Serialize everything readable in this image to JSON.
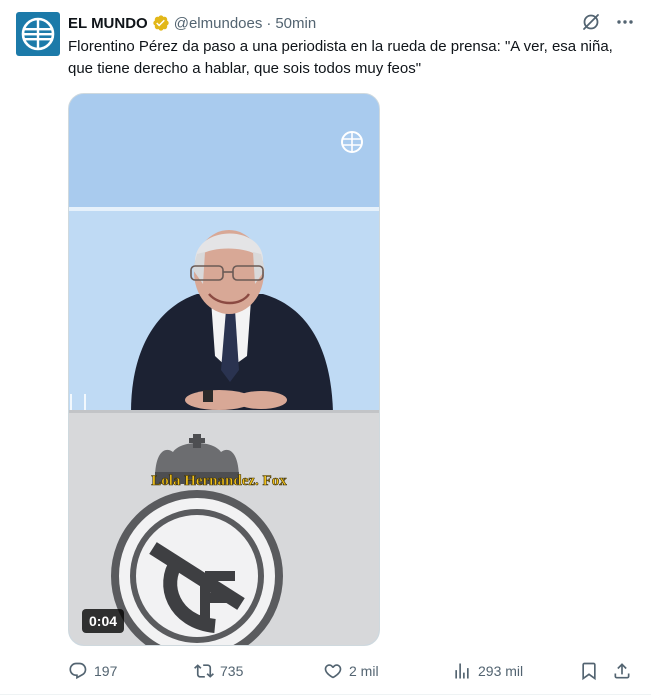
{
  "tweet": {
    "author": {
      "display_name": "EL MUNDO",
      "handle": "@elmundoes",
      "verified_icon": "gold-verified-badge-icon",
      "avatar_icon": "el-mundo-globe-logo"
    },
    "separator": "·",
    "timestamp": "50min",
    "text": "Florentino Pérez da paso a una periodista en la rueda de prensa: \"A ver, esa niña, que tiene derecho a hablar, que sois todos muy feos\"",
    "media": {
      "type": "video",
      "duration": "0:04",
      "caption_overlay": "Lola Hernandez. Fox"
    },
    "top_icons": [
      "grok-icon",
      "more-icon"
    ],
    "actions": {
      "replies": "197",
      "reposts": "735",
      "likes": "2 mil",
      "views": "293 mil"
    },
    "colors": {
      "text": "#0f1419",
      "secondary": "#536471",
      "verified": "#e2b719"
    }
  }
}
